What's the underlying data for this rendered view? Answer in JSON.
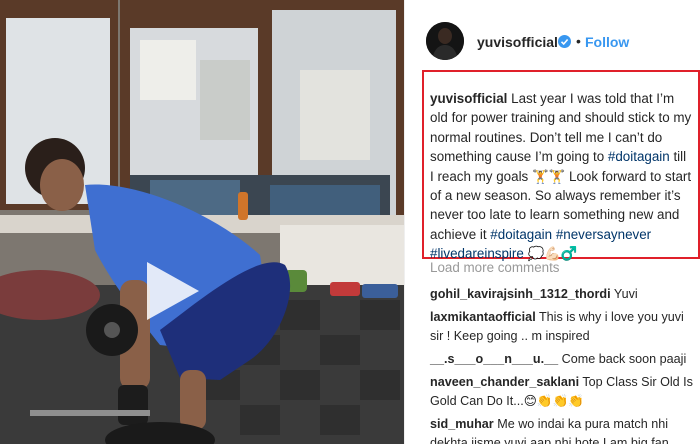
{
  "header": {
    "username": "yuvisofficial",
    "separator": "•",
    "follow_label": "Follow"
  },
  "caption": {
    "author": "yuvisofficial",
    "text_1": " Last year I was told that I’m old for power training and should stick to my normal routines. Don’t tell me I can’t do something cause I’m going to ",
    "tag_1": "#doitagain",
    "text_2": " till I reach my goals 🏋🏋 Look forward to start of a new season. So always remember it’s never too late to learn something new and achieve it ",
    "tag_2": "#doitagain",
    "text_3": " ",
    "tag_3": "#neversaynever",
    "text_4": " ",
    "tag_4": "#livedareinspire",
    "text_5": " 💭💪🏻♂️"
  },
  "load_more_label": "Load more comments",
  "comments": [
    {
      "user": "gohil_kavirajsinh_1312_thordi",
      "text": " Yuvi"
    },
    {
      "user": "laxmikantaofficial",
      "text": " This is why i love you yuvi sir ! Keep going .. m inspired"
    },
    {
      "user": "__.s___o___n___u.__",
      "text": " Come back soon paaji"
    },
    {
      "user": "naveen_chander_saklani",
      "text": " Top Class Sir Old Is Gold Can Do It...😊👏👏👏"
    },
    {
      "user": "sid_muhar",
      "text": " Me wo indai ka pura match nhi dekhta jisme yuvi aap nhi hote I am big fan"
    }
  ],
  "colors": {
    "follow": "#3897f0",
    "hashtag": "#003569",
    "highlight_border": "#e0202a",
    "verified": "#3897f0"
  },
  "icons": {
    "play": "play-icon",
    "verified": "verified-badge-icon"
  }
}
